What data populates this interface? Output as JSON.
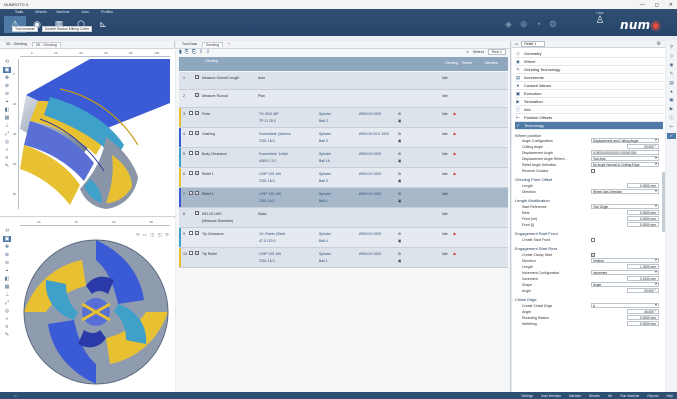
{
  "window": {
    "title": "NUMROTO 3",
    "buttons": [
      "—",
      "◻",
      "✕"
    ]
  },
  "ribbon": {
    "tabs": [
      "Tools",
      "Wheels",
      "Machine",
      "Jobs",
      "Profiles"
    ],
    "subtoolbar": [
      "Tool browser",
      "Double Radius Milling Cutter"
    ],
    "user_label": "User",
    "logo_text": "num",
    "accent": "#4f7aa6"
  },
  "viewport": {
    "tabs": [
      "3D - Grinding",
      "2D - Grinding"
    ],
    "view_controls": "⟲ ▭ ◫ ◰ ⟳",
    "ruler_h": [
      "0",
      "20",
      "40",
      "60",
      "80",
      "100"
    ],
    "ruler_v": [
      "0",
      "20",
      "40",
      "60",
      "80"
    ],
    "ruler_h2": [
      "20",
      "40",
      "60",
      "80"
    ]
  },
  "center": {
    "tabs": [
      "Tool Data",
      "Grinding",
      "+"
    ],
    "toolbar_right_label": "Select",
    "selector": "Rest 1",
    "header": {
      "col1": "Grinding",
      "col2": "Grinding",
      "col3": "Result",
      "col4": "Machine"
    },
    "rows": [
      {
        "num": "1",
        "name": "Measure Overall Length",
        "mode": "Auto",
        "stat": "Idle"
      },
      {
        "num": "2",
        "name": "Measure Runout",
        "mode": "Plan",
        "stat": "Idle"
      },
      {
        "num": "3",
        "name": "Flute",
        "p1": "TV: Ø10 487",
        "p1b": "TP 11 25.0",
        "p2": "Spindel",
        "p2b": "Ball 3",
        "p3": "Ø300.00 1000",
        "p4": "⚙",
        "p4b": "▣",
        "stat": "Idle"
      },
      {
        "num": "4",
        "name": "Gashing",
        "p1": "Formwheel: (diamon",
        "p1b": "2301 16.0",
        "p2": "Spindel",
        "p2b": "Ball 3",
        "p3": "Ø300.00 20.0 1000",
        "p4": "⚙",
        "p4b": "▣",
        "stat": "Idle"
      },
      {
        "num": "5",
        "name": "Body Clearance",
        "p1": "Formwheel: 1v9p6",
        "p1b": "40Ø1.0 2.0",
        "p2": "Spindel",
        "p2b": "Ball 16",
        "p3": "Ø300.00 1000",
        "p4": "⚙",
        "p4b": "▣",
        "stat": "Idle"
      },
      {
        "num": "6",
        "name": "Relief 1",
        "p1": "1V9P 125 160",
        "p1b": "2301 16.0",
        "p2": "Spindel",
        "p2b": "Ball 3",
        "p3": "Ø300.00 1000",
        "p4": "⚙",
        "p4b": "▣",
        "stat": "Idle"
      },
      {
        "num": "7",
        "name": "Relief 1",
        "p1": "1V9P 125 160",
        "p1b": "2301 16.0",
        "p2": "Spindel",
        "p2b": "Ball 1",
        "p3": "Ø300.00 1000",
        "p4": "⚙",
        "p4b": "▣",
        "stat": "Idle"
      },
      {
        "num": "8",
        "name": "Ø11.00 LMO",
        "name2": "(Measure Diameter)",
        "mode": "Static",
        "stat": "Idle"
      },
      {
        "num": "9",
        "name": "Tip Clearance",
        "p1": "1V: Pointe (Steel",
        "p1b": "47.0 120.0",
        "p2": "Spindel",
        "p2b": "Ball 4",
        "p3": "Ø300.00 1000",
        "p4": "⚙",
        "p4b": "▣",
        "stat": "Idle"
      },
      {
        "num": "10",
        "name": "Tip Relief",
        "p1": "1V9P 125 160",
        "p1b": "2301 16.0",
        "p2": "Spindel",
        "p2b": "Ball 1",
        "p3": "Ø300.00 1000",
        "p4": "⚙",
        "p4b": "▣",
        "stat": "Idle"
      }
    ]
  },
  "right": {
    "selector": "Relief 1",
    "categories": [
      "Geometry",
      "Wheel",
      "Grinding Technology",
      "Increments",
      "Coolant Values",
      "Execution",
      "Simulation",
      "Info",
      "Position Offsets",
      "Technology"
    ],
    "sections": {
      "wheel_position": "Wheel position",
      "grinding_point_offset": "Grinding Point Offset",
      "length_modification": "Length Modification",
      "engagement_start_front": "Engagement Start Front",
      "engagement_start_rear": "Engagement Start Rear",
      "chisel_edge": "Chisel Edge"
    },
    "props": {
      "angle_config": {
        "label": "Angle Configuration",
        "value": "Displacement and Cutting Angle"
      },
      "cutting_angle": {
        "label": "Cutting Angle",
        "value": "20.000 °"
      },
      "displacement_angle": {
        "label": "Displacement Angle",
        "value": "0.000/0.000/0.000 0.000/0.000"
      },
      "displacement_ref": {
        "label": "Displacement Angle Refere...",
        "value": "Tool Axis"
      },
      "relief_angle_def": {
        "label": "Relief Angle Definition",
        "value": "By Angle Normal to Cutting Edge"
      },
      "reverse_contact": {
        "label": "Reverse Contact"
      },
      "gpo_length": {
        "label": "Length",
        "value": "0.0000 mm"
      },
      "gpo_direction": {
        "label": "Direction",
        "value": "Wheel Axis Direction"
      },
      "start_reference": {
        "label": "Start Reference",
        "value": "Tool Origin"
      },
      "rear": {
        "label": "Rear",
        "value": "0.0000 mm"
      },
      "front_inc": {
        "label": "Front [rel]",
        "value": "0.0000 mm"
      },
      "front_abs": {
        "label": "Front [t]",
        "value": "0.0000 mm"
      },
      "create_start_front": {
        "label": "Create Start Front"
      },
      "create_clamp": {
        "label": "Create Clamp Start",
        "checked": "✓"
      },
      "rear_direction": {
        "label": "Direction",
        "value": "Vertical"
      },
      "rear_length": {
        "label": "Length",
        "value": "1.0000 mm"
      },
      "increment_config": {
        "label": "Increment Configuration",
        "value": "Increment"
      },
      "increment": {
        "label": "Increment",
        "value": "0.1000 mm"
      },
      "shape": {
        "label": "Shape",
        "value": "Angle"
      },
      "angle": {
        "label": "Angle",
        "value": "20.000 °"
      },
      "create_chisel": {
        "label": "Create Chisel Edge",
        "value": "A"
      },
      "chisel_angle": {
        "label": "Angle",
        "value": "45.000 °"
      },
      "rounding_radius": {
        "label": "Rounding Radius",
        "value": "0.0000 mm"
      },
      "web_thickness": {
        "label": "Webthing",
        "value": "0.0000 mm"
      }
    }
  },
  "status": {
    "items": [
      "Settings",
      "User Interface",
      "Machine",
      "Wheels",
      "Ver",
      "Run Machine",
      "Reports",
      "Help"
    ]
  }
}
